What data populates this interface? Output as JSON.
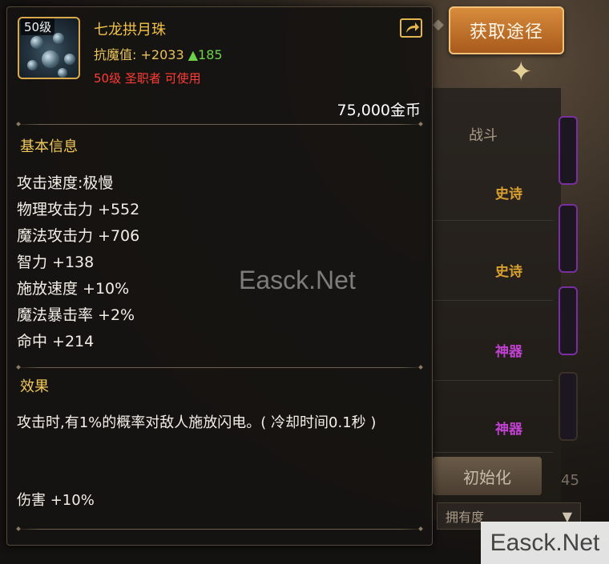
{
  "background": {
    "action_button_label": "获取途径",
    "tab_label": "战斗",
    "item_tags": [
      {
        "text": "史诗",
        "color": "#d9a030"
      },
      {
        "text": "史诗",
        "color": "#d9a030"
      },
      {
        "text": "神器",
        "color": "#c040d0"
      },
      {
        "text": "神器",
        "color": "#c040d0"
      }
    ],
    "reset_button_label": "初始化",
    "dropdown_value": "拥有度",
    "partial_number": "45"
  },
  "tooltip": {
    "item_level_badge": "50级",
    "item_name": "七龙拱月珠",
    "resist_label": "抗魔值:",
    "resist_value": "+2033",
    "resist_delta": "▲185",
    "requirement": "50级 圣职者 可使用",
    "price": "75,000金币",
    "basic_info_title": "基本信息",
    "stats": [
      "攻击速度:极慢",
      "物理攻击力 +552",
      "魔法攻击力 +706",
      "智力 +138",
      "施放速度 +10%",
      "魔法暴击率 +2%",
      "命中 +214"
    ],
    "effect_title": "效果",
    "effect_text": "攻击时,有1%的概率对敌人施放闪电。( 冷却时间0.1秒 )",
    "effect_extra": "伤害 +10%"
  },
  "watermarks": {
    "center": "Easck.Net",
    "corner": "Easck.Net"
  },
  "colors": {
    "gold": "#f0c24a",
    "red": "#ff3b35",
    "green": "#6bd24a",
    "button_orange": "#c8742c"
  },
  "icons": {
    "share": "share-icon",
    "item": "orb-item-icon"
  }
}
